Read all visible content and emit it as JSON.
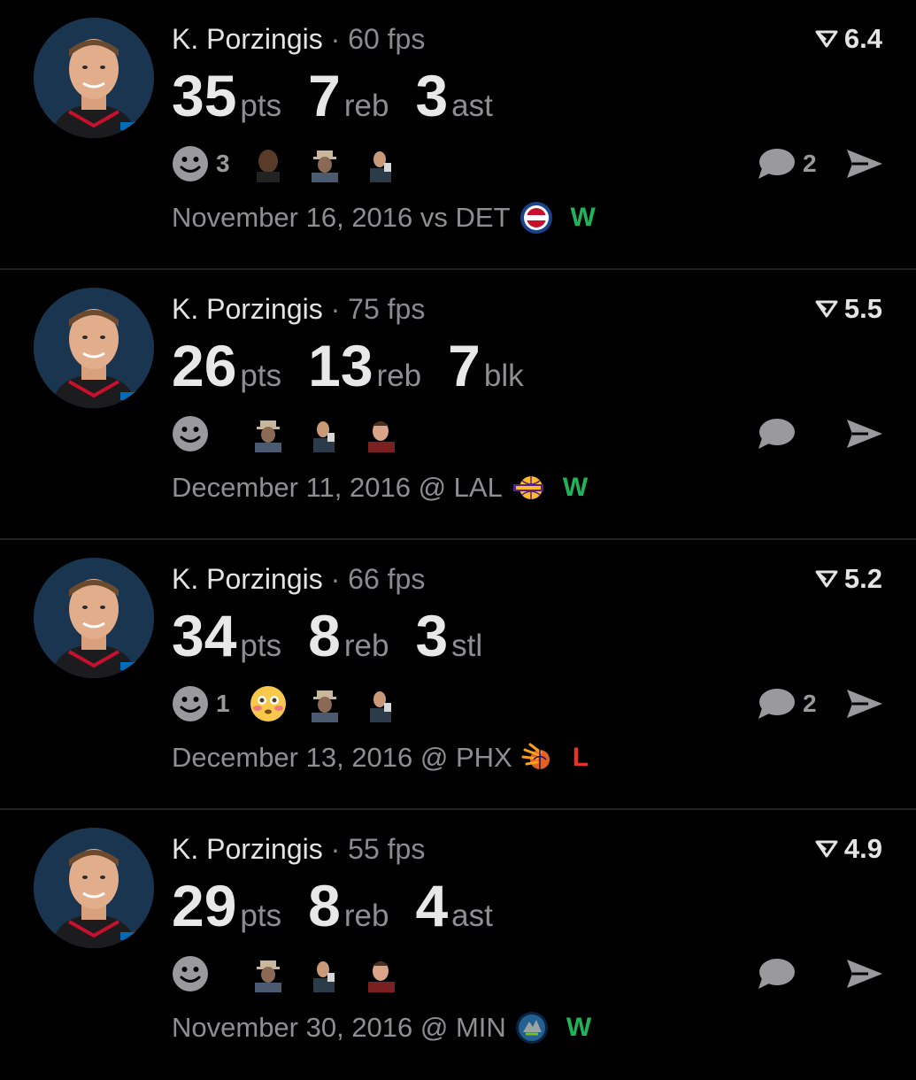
{
  "colors": {
    "background": "#000000",
    "win": "#1fb45a",
    "loss": "#e5322d",
    "muted": "#8f8f93",
    "avatar_bg": "#1a3550"
  },
  "icons": {
    "score": "down-triangle-arrow-icon",
    "reaction": "smiley-icon",
    "comment": "speech-bubble-icon",
    "share": "paper-plane-icon"
  },
  "cards": [
    {
      "player": "K. Porzingis",
      "separator": "·",
      "fps": "60 fps",
      "score": "6.4",
      "stats": [
        {
          "value": "35",
          "unit": "pts"
        },
        {
          "value": "7",
          "unit": "reb"
        },
        {
          "value": "3",
          "unit": "ast"
        }
      ],
      "reaction_count": "3",
      "reactions": [
        "person-thumb-1",
        "person-thumb-2",
        "person-thumb-3"
      ],
      "comment_count": "2",
      "date_line": "November 16, 2016 vs DET",
      "opponent": "DET",
      "result": "W"
    },
    {
      "player": "K. Porzingis",
      "separator": "·",
      "fps": "75 fps",
      "score": "5.5",
      "stats": [
        {
          "value": "26",
          "unit": "pts"
        },
        {
          "value": "13",
          "unit": "reb"
        },
        {
          "value": "7",
          "unit": "blk"
        }
      ],
      "reaction_count": "",
      "reactions": [
        "person-thumb-1",
        "person-thumb-2",
        "person-thumb-3"
      ],
      "comment_count": "",
      "date_line": "December 11, 2016 @ LAL",
      "opponent": "LAL",
      "result": "W"
    },
    {
      "player": "K. Porzingis",
      "separator": "·",
      "fps": "66 fps",
      "score": "5.2",
      "stats": [
        {
          "value": "34",
          "unit": "pts"
        },
        {
          "value": "8",
          "unit": "reb"
        },
        {
          "value": "3",
          "unit": "stl"
        }
      ],
      "reaction_count": "1",
      "reactions": [
        "flushed-emoji",
        "person-thumb-2",
        "person-thumb-3"
      ],
      "comment_count": "2",
      "date_line": "December 13, 2016 @ PHX",
      "opponent": "PHX",
      "result": "L"
    },
    {
      "player": "K. Porzingis",
      "separator": "·",
      "fps": "55 fps",
      "score": "4.9",
      "stats": [
        {
          "value": "29",
          "unit": "pts"
        },
        {
          "value": "8",
          "unit": "reb"
        },
        {
          "value": "4",
          "unit": "ast"
        }
      ],
      "reaction_count": "",
      "reactions": [
        "person-thumb-1",
        "person-thumb-2",
        "person-thumb-3"
      ],
      "comment_count": "",
      "date_line": "November 30, 2016 @ MIN",
      "opponent": "MIN",
      "result": "W"
    }
  ]
}
